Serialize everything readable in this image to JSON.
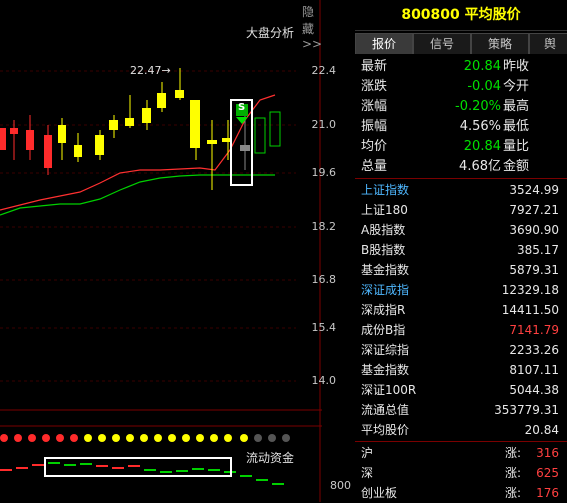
{
  "header": {
    "hide_label": "隐藏>>",
    "analysis_label": "大盘分析"
  },
  "axis": {
    "ticks": [
      "22.4",
      "21.0",
      "19.6",
      "18.2",
      "16.8",
      "15.4",
      "14.0"
    ],
    "bottom_tick": "800"
  },
  "chart": {
    "peak_label": "22.47→",
    "s_marker": "S",
    "flow_label": "流动资金",
    "colors": {
      "up": "#ff2b2b",
      "down": "#ffff00",
      "ma1": "#ff3030",
      "ma2": "#00d000"
    }
  },
  "panel": {
    "title": "800800 平均股价",
    "tabs": [
      "报价",
      "信号",
      "策略",
      "舆"
    ],
    "quote_rows": [
      {
        "label": "最新",
        "value": "20.84",
        "label2": "昨收",
        "color": "green"
      },
      {
        "label": "涨跌",
        "value": "-0.04",
        "label2": "今开",
        "color": "green"
      },
      {
        "label": "涨幅",
        "value": "-0.20%",
        "label2": "最高",
        "color": "green"
      },
      {
        "label": "振幅",
        "value": "4.56%",
        "label2": "最低",
        "color": "white"
      },
      {
        "label": "均价",
        "value": "20.84",
        "label2": "量比",
        "color": "green"
      },
      {
        "label": "总量",
        "value": "4.68亿",
        "label2": "金额",
        "color": "white"
      }
    ],
    "index_rows": [
      {
        "label": "上证指数",
        "value": "3524.99",
        "lcolor": "blue",
        "vcolor": "white"
      },
      {
        "label": "上证180",
        "value": "7927.21",
        "lcolor": "white",
        "vcolor": "white"
      },
      {
        "label": "A股指数",
        "value": "3690.90",
        "lcolor": "white",
        "vcolor": "white"
      },
      {
        "label": "B股指数",
        "value": "385.17",
        "lcolor": "white",
        "vcolor": "white"
      },
      {
        "label": "基金指数",
        "value": "5879.31",
        "lcolor": "white",
        "vcolor": "white"
      },
      {
        "label": "深证成指",
        "value": "12329.18",
        "lcolor": "blue",
        "vcolor": "white"
      },
      {
        "label": "深成指R",
        "value": "14411.50",
        "lcolor": "white",
        "vcolor": "white"
      },
      {
        "label": "成份B指",
        "value": "7141.79",
        "lcolor": "white",
        "vcolor": "red"
      },
      {
        "label": "深证综指",
        "value": "2233.26",
        "lcolor": "white",
        "vcolor": "white"
      },
      {
        "label": "基金指数",
        "value": "8107.11",
        "lcolor": "white",
        "vcolor": "white"
      },
      {
        "label": "深证100R",
        "value": "5044.38",
        "lcolor": "white",
        "vcolor": "white"
      },
      {
        "label": "流通总值",
        "value": "353779.31",
        "lcolor": "white",
        "vcolor": "white"
      },
      {
        "label": "平均股价",
        "value": "20.84",
        "lcolor": "white",
        "vcolor": "white"
      }
    ],
    "market_rows": [
      {
        "label": "沪",
        "mid": "涨:",
        "value": "316"
      },
      {
        "label": "深",
        "mid": "涨:",
        "value": "625"
      },
      {
        "label": "创业板",
        "mid": "涨:",
        "value": "176"
      }
    ]
  }
}
